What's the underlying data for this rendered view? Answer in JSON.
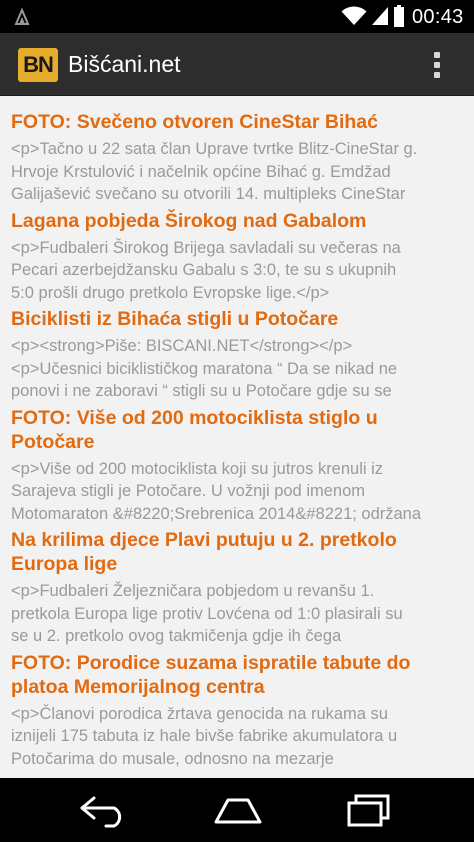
{
  "status": {
    "time": "00:43"
  },
  "app": {
    "logo": "BN",
    "title": "Bišćani.net"
  },
  "articles": [
    {
      "title": "FOTO: Svečeno otvoren CineStar Bihać",
      "snippet_lines": [
        "<p>Tačno u 22 sata član Uprave tvrtke Blitz-CineStar g.",
        "Hrvoje Krstulović i načelnik općine Bihać g. Emdžad",
        "Galijašević svečano su otvorili 14. multipleks CineStar"
      ]
    },
    {
      "title": "Lagana pobjeda Širokog nad Gabalom",
      "snippet_lines": [
        "<p>Fudbaleri Širokog Brijega savladali su večeras na",
        "Pecari azerbejdžansku Gabalu s 3:0, te su s ukupnih",
        "5:0  prošli drugo pretkolo Evropske lige.</p>"
      ]
    },
    {
      "title": "Biciklisti iz Bihaća stigli u Potočare",
      "snippet_lines": [
        "<p><strong>Piše: BISCANI.NET</strong></p>",
        "<p>Učesnici biciklističkog maratona “ Da se nikad ne",
        "ponovi i ne zaboravi “  stigli su u Potočare gdje su se"
      ]
    },
    {
      "title": "FOTO: Više od 200 motociklista stiglo u Potočare",
      "snippet_lines": [
        "<p>Više od 200 motociklista koji su jutros krenuli iz",
        "Sarajeva stigli je Potočare. U vožnji pod imenom",
        "Motomaraton &#8220;Srebrenica 2014&#8221; održana"
      ]
    },
    {
      "title": "Na krilima djece Plavi putuju u 2. pretkolo Europa lige",
      "snippet_lines": [
        "<p>Fudbaleri Željezničara pobjedom u revanšu 1.",
        "pretkola Europa lige protiv Lovćena od 1:0 plasirali su",
        "se u 2. pretkolo ovog takmičenja gdje ih čega"
      ]
    },
    {
      "title": "FOTO: Porodice suzama ispratile tabute do platoa Memorijalnog centra",
      "snippet_lines": [
        "<p>Članovi porodica žrtava genocida na rukama su",
        "iznijeli 175 tabuta iz hale bivše fabrike akumulatora u",
        "Potočarima do musale, odnosno na mezarje"
      ]
    }
  ],
  "icons": {
    "status_left": "flag-icon",
    "wifi": "wifi-icon",
    "signal": "signal-icon",
    "battery": "battery-icon",
    "overflow": "overflow-menu-icon",
    "back": "back-icon",
    "home": "home-icon",
    "recent": "recent-apps-icon"
  },
  "colors": {
    "accent": "#e26b12",
    "logo_bg": "#e6ac2e",
    "action_bar": "#2d2d2d",
    "content_bg": "#f2f2f2",
    "snippet": "#9a9a9a"
  }
}
